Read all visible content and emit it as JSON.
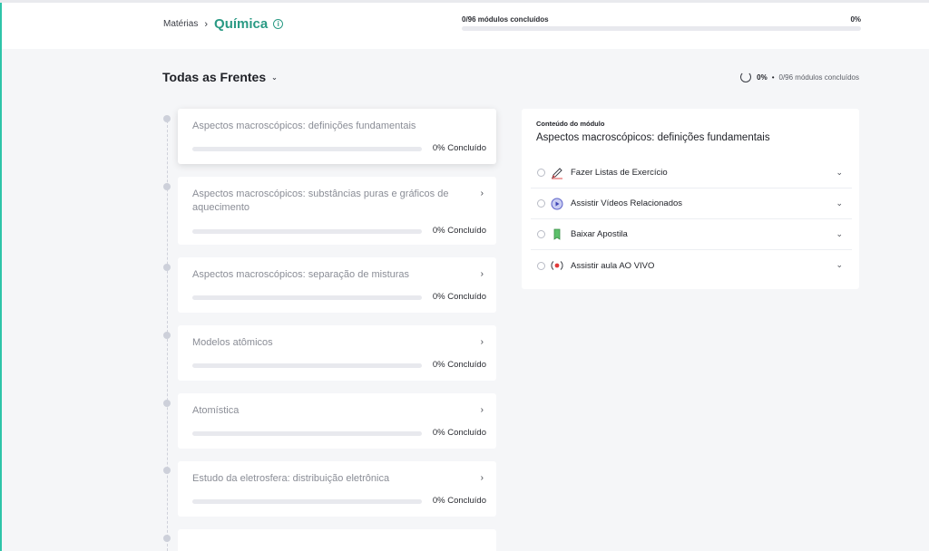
{
  "header": {
    "breadcrumb_parent": "Matérias",
    "breadcrumb_separator": "›",
    "subject": "Química",
    "progress_label": "0/96 módulos concluídos",
    "progress_percent_label": "0%",
    "progress_fraction": 0
  },
  "section": {
    "title": "Todas as Frentes",
    "overall_percent": "0%",
    "overall_label": "0/96 módulos concluídos"
  },
  "modules": [
    {
      "title": "Aspectos macroscópicos: definições fundamentais",
      "status": "0% Concluído",
      "progress": 0,
      "active": true
    },
    {
      "title": "Aspectos macroscópicos: substâncias puras e gráficos de aquecimento",
      "status": "0% Concluído",
      "progress": 0,
      "active": false
    },
    {
      "title": "Aspectos macroscópicos: separação de misturas",
      "status": "0% Concluído",
      "progress": 0,
      "active": false
    },
    {
      "title": "Modelos atômicos",
      "status": "0% Concluído",
      "progress": 0,
      "active": false
    },
    {
      "title": "Atomística",
      "status": "0% Concluído",
      "progress": 0,
      "active": false
    },
    {
      "title": "Estudo da eletrosfera: distribuição eletrônica",
      "status": "0% Concluído",
      "progress": 0,
      "active": false
    }
  ],
  "panel": {
    "kicker": "Conteúdo do módulo",
    "title": "Aspectos macroscópicos: definições fundamentais",
    "activities": [
      {
        "label": "Fazer Listas de Exercício",
        "icon": "pencil-icon"
      },
      {
        "label": "Assistir Vídeos Relacionados",
        "icon": "play-icon"
      },
      {
        "label": "Baixar Apostila",
        "icon": "bookmark-icon"
      },
      {
        "label": "Assistir aula AO VIVO",
        "icon": "live-icon"
      }
    ]
  },
  "colors": {
    "accent": "#2a9a84",
    "page_bg": "#f5f6f8",
    "card_bg": "#ffffff"
  }
}
